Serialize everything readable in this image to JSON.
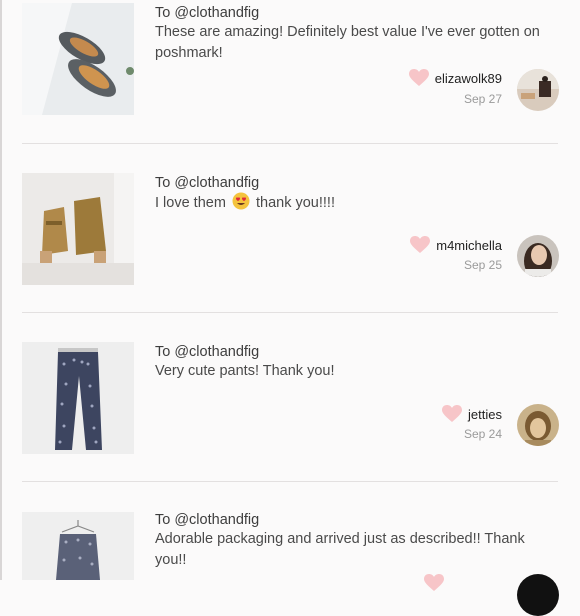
{
  "colors": {
    "heart": "#f7c5c8",
    "divider": "#e3e0e0",
    "text": "#4a4a4a",
    "date": "#9a9a9a"
  },
  "love_notes": [
    {
      "to": "To @clothandfig",
      "message": "These are amazing! Definitely best value I've ever gotten on poshmark!",
      "username": "elizawolk89",
      "date": "Sep 27",
      "product_icon": "ballet-flats",
      "avatar_icon": "avatar-photo"
    },
    {
      "to": "To @clothandfig",
      "message_before": "I love them",
      "message_emoji": "heart-eyes-emoji",
      "message_after": "thank you!!!!",
      "username": "m4michella",
      "date": "Sep 25",
      "product_icon": "ankle-boots",
      "avatar_icon": "avatar-photo"
    },
    {
      "to": "To @clothandfig",
      "message": "Very cute pants! Thank you!",
      "username": "jetties",
      "date": "Sep 24",
      "product_icon": "printed-pants",
      "avatar_icon": "avatar-photo"
    },
    {
      "to": "To @clothandfig",
      "message": "Adorable packaging and arrived just as described!! Thank you!!",
      "product_icon": "printed-pants-hanger"
    }
  ]
}
